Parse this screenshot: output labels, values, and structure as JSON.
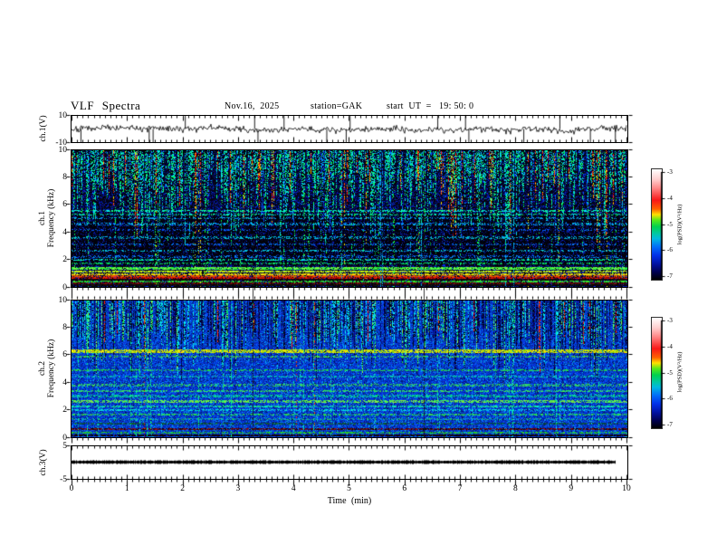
{
  "header": {
    "title": "VLF  Spectra",
    "date": "Nov.16,  2025",
    "station": "station=GAK",
    "start_ut": "start  UT  =   19: 50: 0"
  },
  "xaxis": {
    "label": "Time  (min)",
    "range": [
      0,
      10
    ],
    "major_ticks": [
      "0",
      "1",
      "2",
      "3",
      "4",
      "5",
      "6",
      "7",
      "8",
      "9",
      "10"
    ],
    "minor_step_min": 0.1
  },
  "colorbar": {
    "title": "log(PSD)(V²/Hz)",
    "ticks": [
      "-3",
      "-4",
      "-5",
      "-6",
      "-7"
    ],
    "range": [
      -7,
      -3
    ],
    "stops": [
      [
        "#ffffff",
        0
      ],
      [
        "#ffd0d0",
        0.09
      ],
      [
        "#ff8888",
        0.17
      ],
      [
        "#f81818",
        0.28
      ],
      [
        "#ff6000",
        0.36
      ],
      [
        "#ffe000",
        0.41
      ],
      [
        "#58e818",
        0.46
      ],
      [
        "#00d050",
        0.52
      ],
      [
        "#00c8a0",
        0.58
      ],
      [
        "#00b8e0",
        0.63
      ],
      [
        "#0070f8",
        0.7
      ],
      [
        "#0030e8",
        0.78
      ],
      [
        "#0010a0",
        0.86
      ],
      [
        "#000050",
        0.93
      ],
      [
        "#000000",
        1
      ]
    ]
  },
  "chart_data": [
    {
      "type": "line",
      "panel": "ch1-waveform",
      "ylabel": "ch.1(V)",
      "ylim": [
        -10,
        10
      ],
      "ytick_labels": [
        "10",
        "-10"
      ],
      "ytick_values": [
        10,
        -10
      ],
      "description": "broadband noise of about +/-1.5 V around 0 V with impulsive sferic spikes",
      "noise_sigma_v": 0.8,
      "spikes": [
        {
          "t": 0.17,
          "v": -4
        },
        {
          "t": 1.4,
          "v": -8.5
        },
        {
          "t": 1.47,
          "v": -5
        },
        {
          "t": 2.05,
          "v": 4
        },
        {
          "t": 3.3,
          "v": 5
        },
        {
          "t": 3.36,
          "v": -4
        },
        {
          "t": 3.83,
          "v": 6
        },
        {
          "t": 4.6,
          "v": -4
        },
        {
          "t": 4.95,
          "v": -9
        },
        {
          "t": 5.02,
          "v": 4
        },
        {
          "t": 6.6,
          "v": 4
        },
        {
          "t": 7.1,
          "v": 7
        },
        {
          "t": 7.16,
          "v": -5
        },
        {
          "t": 8.15,
          "v": -4
        },
        {
          "t": 8.8,
          "v": 5
        },
        {
          "t": 9.35,
          "v": -6
        },
        {
          "t": 9.8,
          "v": -4
        }
      ]
    },
    {
      "type": "heatmap",
      "panel": "ch1-spectrogram",
      "ylabel_line1": "ch.1",
      "ylabel_line2": "Frequency  (kHz)",
      "ylim": [
        0,
        10
      ],
      "ytick_labels": [
        "10",
        "8",
        "6",
        "4",
        "2",
        "0"
      ],
      "ytick_values": [
        10,
        8,
        6,
        4,
        2,
        0
      ],
      "value_range_log_psd": [
        -7,
        -3
      ],
      "description": "dense green/cyan vertical sferic streaks above ~5.5 kHz with occasional red/yellow, dark background 1.5-5.5 kHz with thin cyan horizontal lines, bright green/yellow/red horizontal bands below 1.5 kHz",
      "background": {
        "colors": [
          "#000010",
          "#001078",
          "#0028d8",
          "#000428"
        ],
        "weights": [
          0.5,
          0.28,
          0.12,
          0.1
        ],
        "dark_region": [
          1.6,
          5.4,
          0.5
        ]
      },
      "streaks": {
        "density": 0.8,
        "depth": [
          0.16,
          0.62
        ],
        "palettes": [
          {
            "p": 0.77,
            "colors": [
              "#00e858",
              "#00ff90",
              "#00e8e8",
              "#00b8ff"
            ]
          },
          {
            "p": 0.13,
            "colors": [
              "#ffe800",
              "#ff9000",
              "#ff3000",
              "#f80000"
            ]
          },
          {
            "p": 0.1,
            "colors": [
              "#0048ff",
              "#0078ff"
            ]
          }
        ]
      },
      "bands": [
        {
          "f": 5.55,
          "hw": 0.06,
          "colors": [
            "#00e8e8",
            "#00ff80"
          ],
          "d": 0.55
        },
        {
          "f": 5.3,
          "hw": 0.05,
          "colors": [
            "#00d060",
            "#00e8e8"
          ],
          "d": 0.4
        },
        {
          "f": 5.05,
          "hw": 0.05,
          "colors": [
            "#00a0e0"
          ],
          "d": 0.35
        },
        {
          "f": 4.6,
          "hw": 0.05,
          "colors": [
            "#00c8e8",
            "#0080ff"
          ],
          "d": 0.4
        },
        {
          "f": 4.15,
          "hw": 0.04,
          "colors": [
            "#0060ff"
          ],
          "d": 0.3
        },
        {
          "f": 3.6,
          "hw": 0.05,
          "colors": [
            "#00b8d8"
          ],
          "d": 0.35
        },
        {
          "f": 3.1,
          "hw": 0.04,
          "colors": [
            "#0070ff"
          ],
          "d": 0.3
        },
        {
          "f": 2.65,
          "hw": 0.05,
          "colors": [
            "#00c0e0"
          ],
          "d": 0.4
        },
        {
          "f": 2.2,
          "hw": 0.04,
          "colors": [
            "#0080ff"
          ],
          "d": 0.3
        },
        {
          "f": 1.95,
          "hw": 0.05,
          "colors": [
            "#00e0e0",
            "#00ff80"
          ],
          "d": 0.5
        },
        {
          "f": 1.7,
          "hw": 0.04,
          "colors": [
            "#00d860"
          ],
          "d": 0.45
        },
        {
          "f": 1.35,
          "hw": 0.09,
          "colors": [
            "#20e840",
            "#80ff40"
          ],
          "d": 0.85
        },
        {
          "f": 1.1,
          "hw": 0.07,
          "colors": [
            "#a8e820",
            "#d8f800"
          ],
          "d": 0.8
        },
        {
          "f": 0.92,
          "hw": 0.06,
          "colors": [
            "#ffe800",
            "#c8c800"
          ],
          "d": 0.75
        },
        {
          "f": 0.78,
          "hw": 0.06,
          "colors": [
            "#c86000",
            "#f84000"
          ],
          "d": 0.7
        },
        {
          "f": 0.62,
          "hw": 0.06,
          "colors": [
            "#e81800",
            "#900000"
          ],
          "d": 0.8
        },
        {
          "f": 0.48,
          "hw": 0.05,
          "colors": [
            "#200000",
            "#000000"
          ],
          "d": 0.85
        },
        {
          "f": 0.35,
          "hw": 0.04,
          "colors": [
            "#30e830"
          ],
          "d": 0.6
        },
        {
          "f": 0.22,
          "hw": 0.05,
          "colors": [
            "#800808",
            "#300000"
          ],
          "d": 0.75
        },
        {
          "f": 0.1,
          "hw": 0.06,
          "colors": [
            "#000000",
            "#101010"
          ],
          "d": 0.9
        }
      ],
      "vertical_line_density": 0.025,
      "vertical_line_color": "#00a0d8",
      "impulse_times_min": [
        3.27,
        6.35
      ]
    },
    {
      "type": "heatmap",
      "panel": "ch2-spectrogram",
      "ylabel_line1": "ch.2",
      "ylabel_line2": "Frequency  (kHz)",
      "ylim": [
        0,
        10
      ],
      "ytick_labels": [
        "10",
        "8",
        "6",
        "4",
        "2",
        "0"
      ],
      "ytick_values": [
        10,
        8,
        6,
        4,
        2,
        0
      ],
      "value_range_log_psd": [
        -7,
        -3
      ],
      "description": "blue background with navy/cyan vertical streaks above ~7 kHz, yellow-green band near 6.3 kHz with orange blobs, multiple green horizontal bands 1.5-3.5 kHz, dark red band near 0.5 kHz",
      "background": {
        "colors": [
          "#0038d8",
          "#0028a0",
          "#0058f8",
          "#00a0e8",
          "#001870"
        ],
        "weights": [
          0.42,
          0.22,
          0.16,
          0.1,
          0.1
        ],
        "dark_region": null
      },
      "streaks": {
        "density": 0.65,
        "depth": [
          0.22,
          0.5
        ],
        "palettes": [
          {
            "p": 0.45,
            "colors": [
              "#000078",
              "#000040"
            ]
          },
          {
            "p": 0.3,
            "colors": [
              "#00c8e8",
              "#00e8f8"
            ]
          },
          {
            "p": 0.2,
            "colors": [
              "#00e060",
              "#80f860"
            ]
          },
          {
            "p": 0.05,
            "colors": [
              "#f83000"
            ]
          }
        ]
      },
      "bands": [
        {
          "f": 6.3,
          "hw": 0.13,
          "colors": [
            "#b8e800",
            "#ffe800",
            "#88c810"
          ],
          "d": 0.8,
          "sparse": "#ff8800"
        },
        {
          "f": 5.9,
          "hw": 0.05,
          "colors": [
            "#40d040"
          ],
          "d": 0.4
        },
        {
          "f": 4.9,
          "hw": 0.06,
          "colors": [
            "#20d050"
          ],
          "d": 0.5
        },
        {
          "f": 4.45,
          "hw": 0.05,
          "colors": [
            "#00c8b0"
          ],
          "d": 0.45
        },
        {
          "f": 3.8,
          "hw": 0.05,
          "colors": [
            "#30d060"
          ],
          "d": 0.45
        },
        {
          "f": 3.35,
          "hw": 0.06,
          "colors": [
            "#30e060"
          ],
          "d": 0.55
        },
        {
          "f": 3.0,
          "hw": 0.06,
          "colors": [
            "#00d090"
          ],
          "d": 0.5
        },
        {
          "f": 2.6,
          "hw": 0.08,
          "colors": [
            "#38e858",
            "#80e840"
          ],
          "d": 0.65
        },
        {
          "f": 2.25,
          "hw": 0.07,
          "colors": [
            "#20d870",
            "#00e8c0"
          ],
          "d": 0.6
        },
        {
          "f": 1.95,
          "hw": 0.06,
          "colors": [
            "#00d8d8"
          ],
          "d": 0.5
        },
        {
          "f": 1.65,
          "hw": 0.06,
          "colors": [
            "#28d858"
          ],
          "d": 0.5
        },
        {
          "f": 1.3,
          "hw": 0.06,
          "colors": [
            "#0090e0",
            "#20c060"
          ],
          "d": 0.45
        },
        {
          "f": 0.95,
          "hw": 0.07,
          "colors": [
            "#106838",
            "#004830"
          ],
          "d": 0.55
        },
        {
          "f": 0.55,
          "hw": 0.07,
          "colors": [
            "#500000",
            "#000000",
            "#900808"
          ],
          "d": 0.8
        },
        {
          "f": 0.3,
          "hw": 0.05,
          "colors": [
            "#28c828"
          ],
          "d": 0.55
        },
        {
          "f": 0.12,
          "hw": 0.06,
          "colors": [
            "#000000",
            "#200000"
          ],
          "d": 0.85
        }
      ],
      "vertical_line_density": 0.03,
      "vertical_line_color": "#00e890",
      "impulse_times_min": [
        3.27,
        6.35
      ]
    },
    {
      "type": "line",
      "panel": "ch3-waveform",
      "ylabel": "ch.3(V)",
      "ylim": [
        -5,
        5
      ],
      "ytick_labels": [
        "5",
        "-5"
      ],
      "ytick_values": [
        5,
        -5
      ],
      "description": "dense saturated trace drawn as a thick flat black bar at 0 V from t=0 to t=9.8 min",
      "bar_start_min": 0,
      "bar_end_min": 9.8,
      "bar_level_v": 0
    }
  ]
}
